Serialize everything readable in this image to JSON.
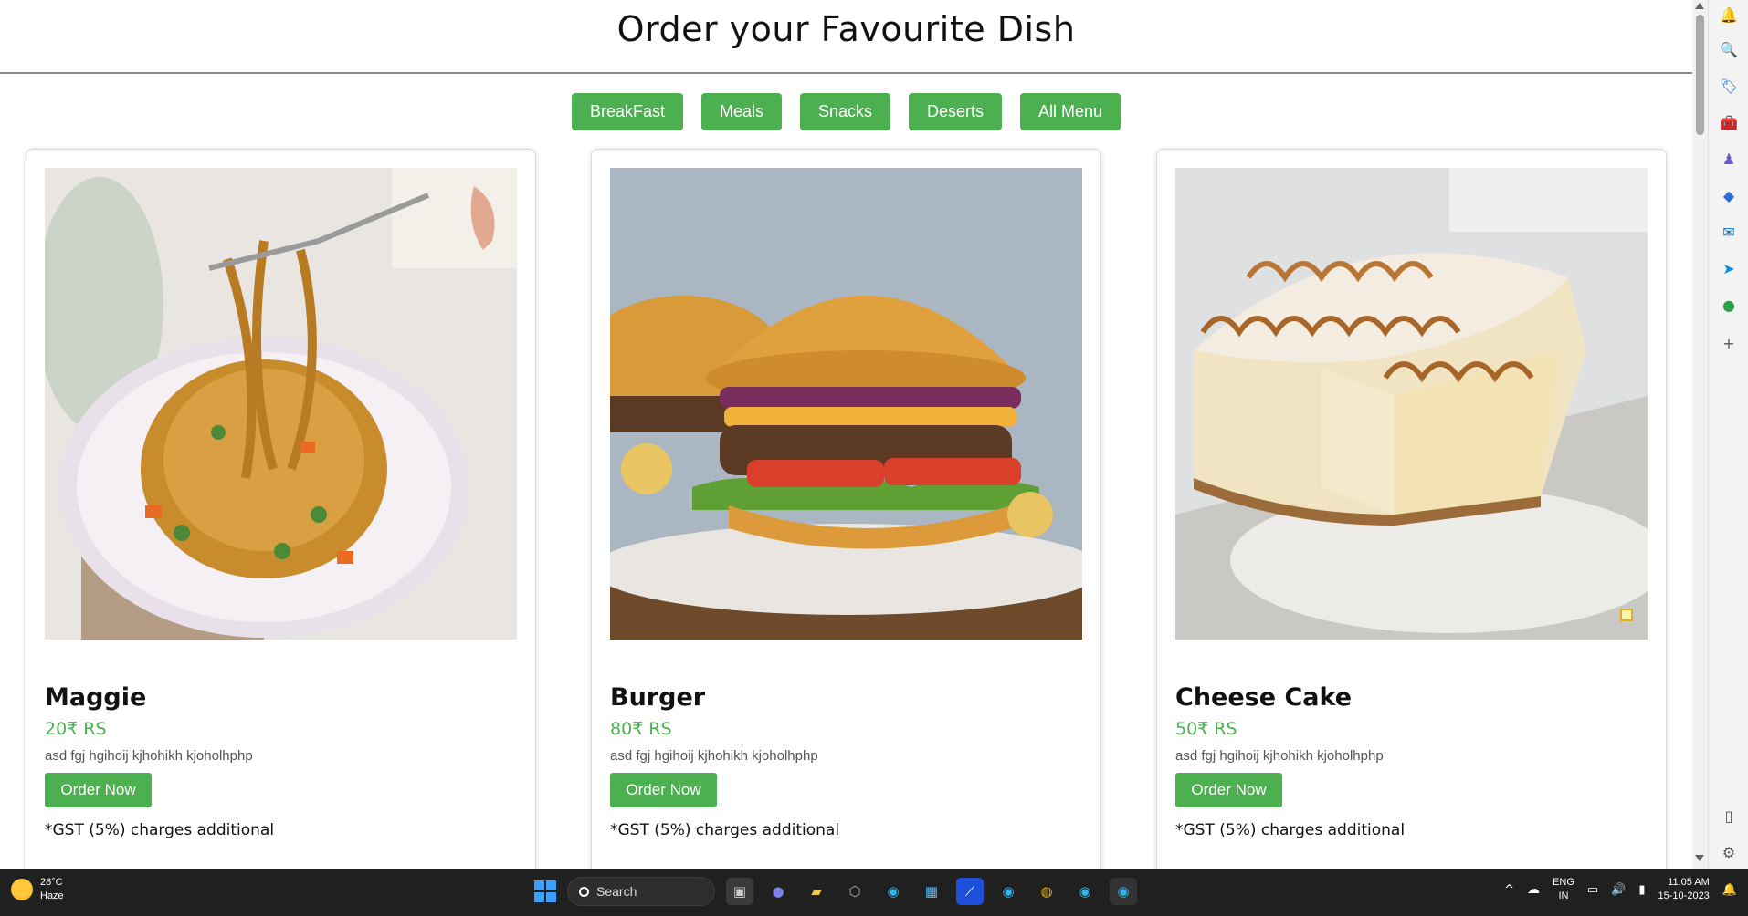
{
  "page": {
    "title": "Order your Favourite Dish"
  },
  "nav": [
    {
      "label": "BreakFast"
    },
    {
      "label": "Meals"
    },
    {
      "label": "Snacks"
    },
    {
      "label": "Deserts"
    },
    {
      "label": "All Menu"
    }
  ],
  "cards": [
    {
      "name": "Maggie",
      "price": "20₹ RS",
      "description": "asd fgj hgihoij kjhohikh kjoholhphp",
      "button": "Order Now",
      "note": "*GST (5%) charges additional",
      "image": "maggie-noodles-image"
    },
    {
      "name": "Burger",
      "price": "80₹ RS",
      "description": "asd fgj hgihoij kjhohikh kjoholhphp",
      "button": "Order Now",
      "note": "*GST (5%) charges additional",
      "image": "burger-image"
    },
    {
      "name": "Cheese Cake",
      "price": "50₹ RS",
      "description": "asd fgj hgihoij kjhohikh kjoholhphp",
      "button": "Order Now",
      "note": "*GST (5%) charges additional",
      "image": "cheese-cake-image"
    }
  ],
  "taskbar": {
    "weather_temp": "28°C",
    "weather_desc": "Haze",
    "search_label": "Search",
    "lang_top": "ENG",
    "lang_bottom": "IN",
    "time": "11:05 AM",
    "date": "15-10-2023"
  },
  "colors": {
    "accent": "#4caf50",
    "taskbar": "#202020"
  }
}
